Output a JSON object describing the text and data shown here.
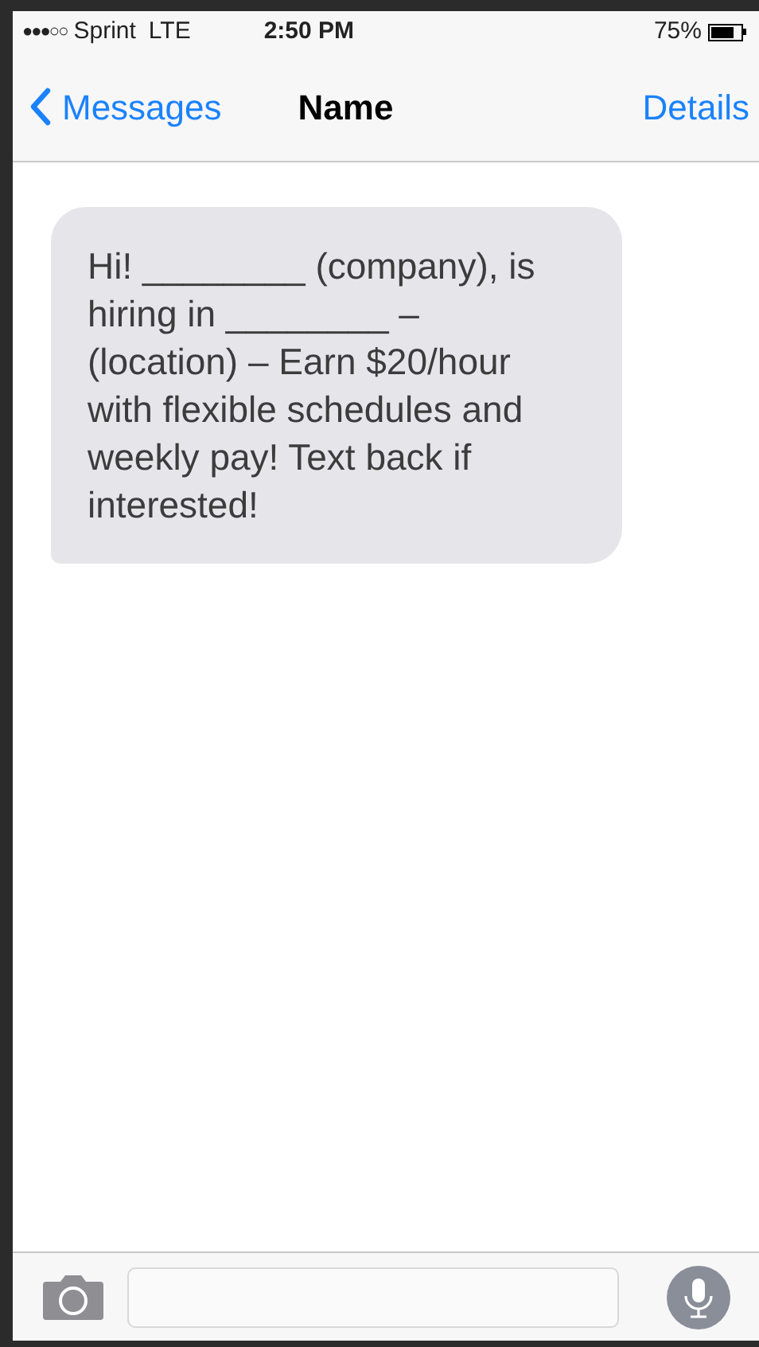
{
  "status_bar": {
    "signal": "●●●○○",
    "carrier": "Sprint",
    "network": "LTE",
    "time": "2:50 PM",
    "battery": "75%"
  },
  "nav": {
    "back": "Messages",
    "title": "Name",
    "action": "Details"
  },
  "messages": [
    {
      "kind": "incoming",
      "text": "Hi! ________ (company), is hiring in ________ – (location) – Earn $20/hour with flexible schedules and weekly pay! Text back if interested!"
    }
  ]
}
